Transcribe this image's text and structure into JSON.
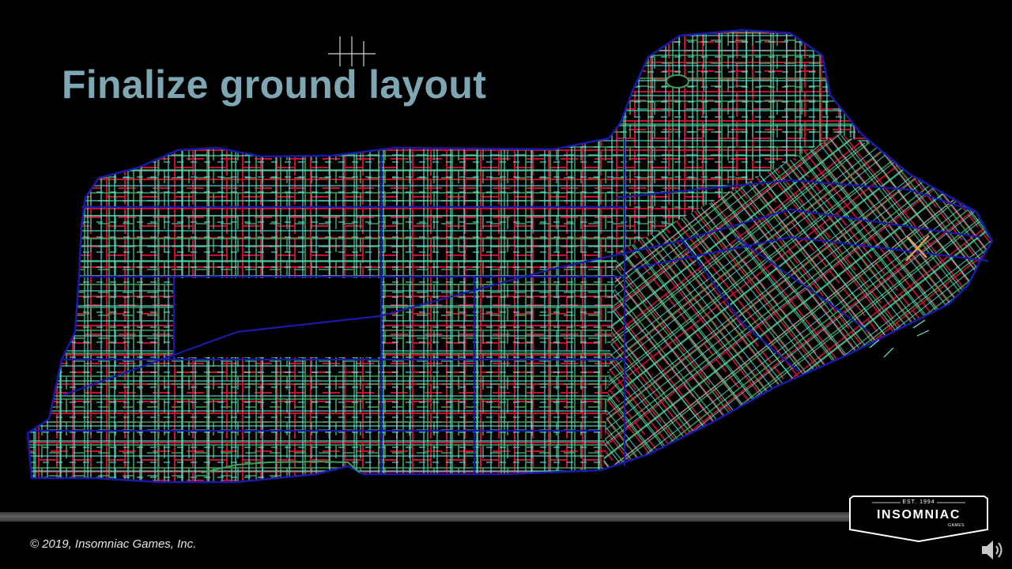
{
  "slide": {
    "title": "Finalize ground layout",
    "copyright": "© 2019, Insomniac Games, Inc.",
    "map_icon": "city-street-map",
    "colors": {
      "background": "#000000",
      "title": "#7ea6b3",
      "coast": "#1a1aa8",
      "highway": "#1a1aa8",
      "street_red": "#c8102e",
      "street_green": "#3fa05a",
      "alley_cyan": "#5ff0e6"
    }
  },
  "logo": {
    "est": "EST. 1994",
    "name": "INSOMNIAC",
    "sub": "GAMES"
  },
  "audio": {
    "icon": "speaker-icon"
  }
}
